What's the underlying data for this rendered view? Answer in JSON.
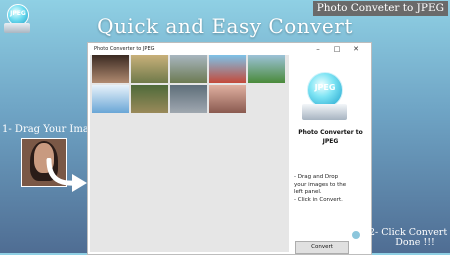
{
  "promo": {
    "headline": "Quick and Easy Convert",
    "corner_title": "Photo Conveter to JPEG",
    "logo_text": "JPEG",
    "step1": "1- Drag Your Images",
    "step2_line1": "2- Click Convert",
    "step2_line2": "Done !!!"
  },
  "window": {
    "title": "Photo Converter to JPEG",
    "buttons": {
      "minimize": "–",
      "maximize": "□",
      "close": "✕"
    }
  },
  "right_panel": {
    "logo_text": "JPEG",
    "app_name_line1": "Photo Converter to",
    "app_name_line2": "JPEG",
    "instructions": "- Drag and Drop\nyour images to the\nleft panel.\n- Click in Convert.",
    "convert_label": "Convert"
  },
  "thumbnails": [
    {
      "name": "woman-portrait",
      "colors": [
        "#3a2a22",
        "#b08a70"
      ]
    },
    {
      "name": "field-sunset",
      "colors": [
        "#c8b07a",
        "#6f7a4a"
      ]
    },
    {
      "name": "tree-landscape",
      "colors": [
        "#a8b6c0",
        "#6c7a52"
      ]
    },
    {
      "name": "balloons-sky",
      "colors": [
        "#7ec2e8",
        "#c44a3a"
      ]
    },
    {
      "name": "green-meadow",
      "colors": [
        "#9cc2d8",
        "#4a8a3a"
      ]
    },
    {
      "name": "blue-sky-clouds",
      "colors": [
        "#e8f2fa",
        "#6aa6d6"
      ]
    },
    {
      "name": "children-park",
      "colors": [
        "#4e6a3a",
        "#9a8a5a"
      ]
    },
    {
      "name": "man-silhouette",
      "colors": [
        "#5e6e7a",
        "#a0a8b0"
      ]
    },
    {
      "name": "pink-sunset",
      "colors": [
        "#e0b0a0",
        "#8a5a50"
      ]
    }
  ],
  "colors": {
    "window_left_panel": "#e6e6e6",
    "accent": "#1aa0cb"
  }
}
